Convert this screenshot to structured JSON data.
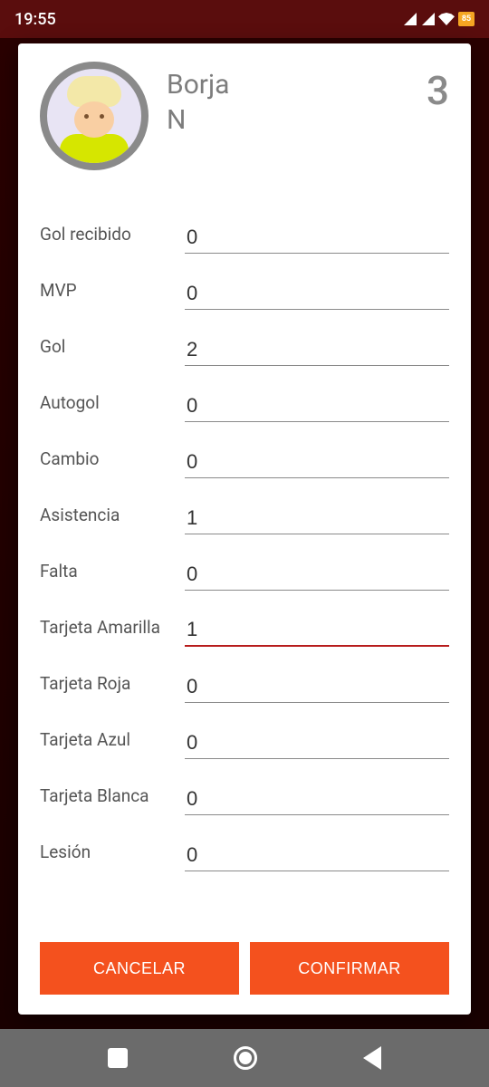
{
  "status": {
    "time": "19:55",
    "battery": "85"
  },
  "player": {
    "first_name": "Borja",
    "last_name": "N",
    "number": "3"
  },
  "stats": [
    {
      "label": "Gol recibido",
      "value": "0",
      "active": false
    },
    {
      "label": "MVP",
      "value": "0",
      "active": false
    },
    {
      "label": "Gol",
      "value": "2",
      "active": false
    },
    {
      "label": "Autogol",
      "value": "0",
      "active": false
    },
    {
      "label": "Cambio",
      "value": "0",
      "active": false
    },
    {
      "label": "Asistencia",
      "value": "1",
      "active": false
    },
    {
      "label": "Falta",
      "value": "0",
      "active": false
    },
    {
      "label": "Tarjeta Amarilla",
      "value": "1",
      "active": true
    },
    {
      "label": "Tarjeta Roja",
      "value": "0",
      "active": false
    },
    {
      "label": "Tarjeta Azul",
      "value": "0",
      "active": false
    },
    {
      "label": "Tarjeta Blanca",
      "value": "0",
      "active": false
    },
    {
      "label": "Lesión",
      "value": "0",
      "active": false
    }
  ],
  "buttons": {
    "cancel": "CANCELAR",
    "confirm": "CONFIRMAR"
  }
}
